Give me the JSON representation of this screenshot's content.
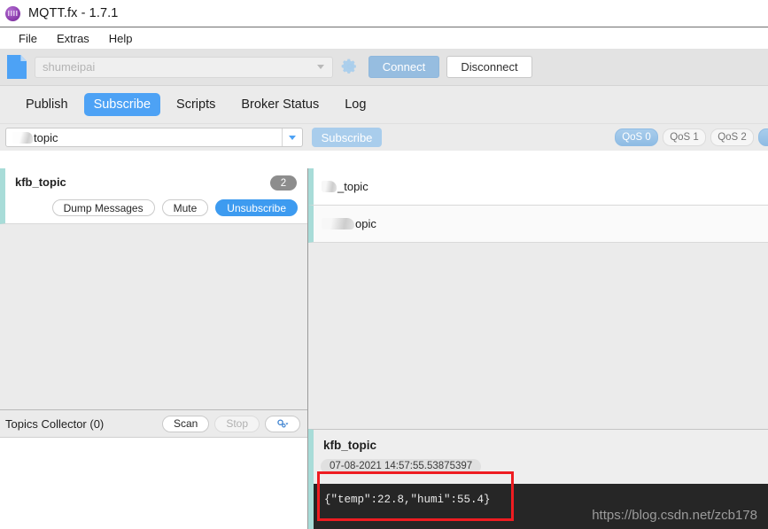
{
  "window": {
    "title": "MQTT.fx - 1.7.1",
    "logo_icon": "mqttfx-logo-icon"
  },
  "menubar": {
    "items": [
      {
        "label": "File"
      },
      {
        "label": "Extras"
      },
      {
        "label": "Help"
      }
    ]
  },
  "connection_bar": {
    "file_icon": "file-document-icon",
    "profile_value": "shumeipai",
    "profile_placeholder": "shumeipai",
    "gear_icon": "gear-icon",
    "connect_label": "Connect",
    "disconnect_label": "Disconnect"
  },
  "tabs": [
    {
      "label": "Publish",
      "active": false
    },
    {
      "label": "Subscribe",
      "active": true
    },
    {
      "label": "Scripts",
      "active": false
    },
    {
      "label": "Broker Status",
      "active": false
    },
    {
      "label": "Log",
      "active": false
    }
  ],
  "subscribe_bar": {
    "topic_value": "topic",
    "topic_redacted": true,
    "dropdown_icon": "chevron-down-icon",
    "subscribe_label": "Subscribe",
    "qos_options": [
      {
        "label": "QoS 0",
        "selected": true
      },
      {
        "label": "QoS 1",
        "selected": false
      },
      {
        "label": "QoS 2",
        "selected": false
      }
    ]
  },
  "subscriptions": [
    {
      "topic": "kfb_topic",
      "count": "2",
      "dump_label": "Dump Messages",
      "mute_label": "Mute",
      "unsubscribe_label": "Unsubscribe"
    }
  ],
  "topics_collector": {
    "title": "Topics Collector (0)",
    "scan_label": "Scan",
    "stop_label": "Stop",
    "stop_disabled": true,
    "settings_icon": "gear-dropdown-icon"
  },
  "messages": [
    {
      "topic_suffix": "_topic",
      "selected": false
    },
    {
      "topic_suffix": "opic",
      "selected": false
    }
  ],
  "detail": {
    "topic": "kfb_topic",
    "timestamp": "07-08-2021 14:57:55.53875397",
    "payload": "{\"temp\":22.8,\"humi\":55.4}"
  },
  "watermark": {
    "text": "https://blog.csdn.net/zcb178"
  },
  "colors": {
    "accent_blue": "#4da2f5",
    "teal_marker": "#a8dcd8",
    "highlight_red": "#ee1c21",
    "payload_bg": "#262626"
  }
}
